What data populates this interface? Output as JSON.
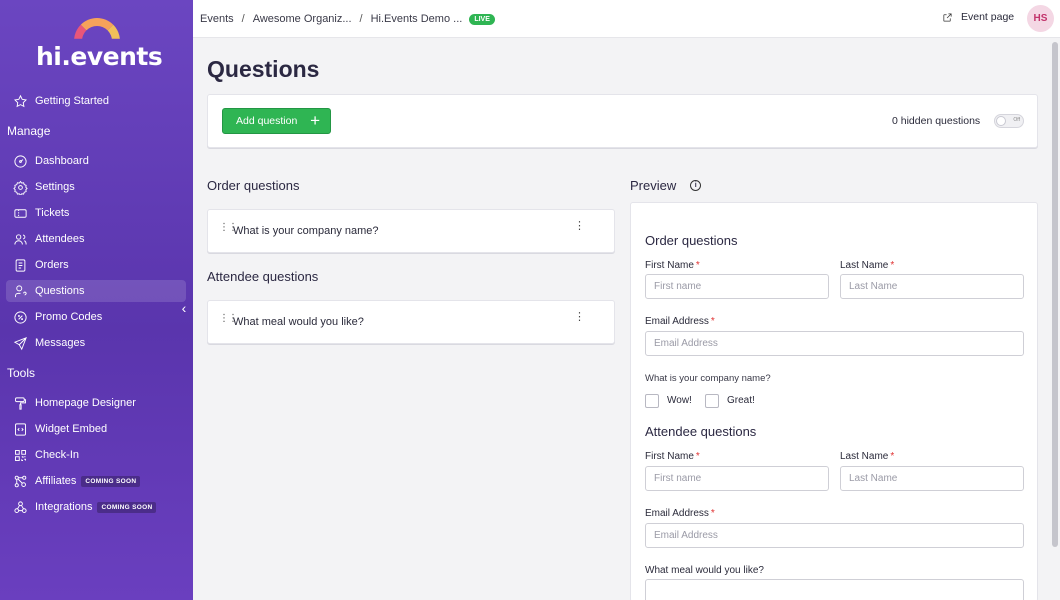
{
  "brand": {
    "logo_text": "hi.events"
  },
  "sidebar": {
    "getting_started": "Getting Started",
    "manage_label": "Manage",
    "manage_items": [
      {
        "label": "Dashboard",
        "icon": "gauge-icon"
      },
      {
        "label": "Settings",
        "icon": "gear-icon"
      },
      {
        "label": "Tickets",
        "icon": "ticket-icon"
      },
      {
        "label": "Attendees",
        "icon": "users-icon"
      },
      {
        "label": "Orders",
        "icon": "receipt-icon"
      },
      {
        "label": "Questions",
        "icon": "user-question-icon",
        "active": true
      },
      {
        "label": "Promo Codes",
        "icon": "discount-icon"
      },
      {
        "label": "Messages",
        "icon": "send-icon"
      }
    ],
    "tools_label": "Tools",
    "tools_items": [
      {
        "label": "Homepage Designer",
        "icon": "paint-roller-icon"
      },
      {
        "label": "Widget Embed",
        "icon": "embed-icon"
      },
      {
        "label": "Check-In",
        "icon": "qr-icon"
      },
      {
        "label": "Affiliates",
        "icon": "affiliate-icon",
        "badge": "COMING SOON"
      },
      {
        "label": "Integrations",
        "icon": "webhook-icon",
        "badge": "COMING SOON"
      }
    ]
  },
  "topbar": {
    "breadcrumbs": [
      "Events",
      "Awesome Organiz...",
      "Hi.Events Demo ..."
    ],
    "live_badge": "LIVE",
    "event_page": "Event page",
    "avatar_initials": "HS"
  },
  "page": {
    "title": "Questions",
    "add_question": "Add question",
    "hidden_questions": "0 hidden questions",
    "toggle_label": "Off"
  },
  "order_questions": {
    "heading": "Order questions",
    "items": [
      "What is your company name?"
    ]
  },
  "attendee_questions": {
    "heading": "Attendee questions",
    "items": [
      "What meal would you like?"
    ]
  },
  "preview": {
    "title": "Preview",
    "order_heading": "Order questions",
    "first_name_label": "First Name",
    "first_name_placeholder": "First name",
    "last_name_label": "Last Name",
    "last_name_placeholder": "Last Name",
    "email_label": "Email Address",
    "email_placeholder": "Email Address",
    "company_question": "What is your company name?",
    "options": [
      "Wow!",
      "Great!"
    ],
    "attendee_heading": "Attendee questions",
    "attendee_first_name_label": "First Name",
    "attendee_first_name_placeholder": "First name",
    "attendee_last_name_label": "Last Name",
    "attendee_last_name_placeholder": "Last Name",
    "attendee_email_label": "Email Address",
    "attendee_email_placeholder": "Email Address",
    "meal_question": "What meal would you like?",
    "required_mark": "*"
  }
}
